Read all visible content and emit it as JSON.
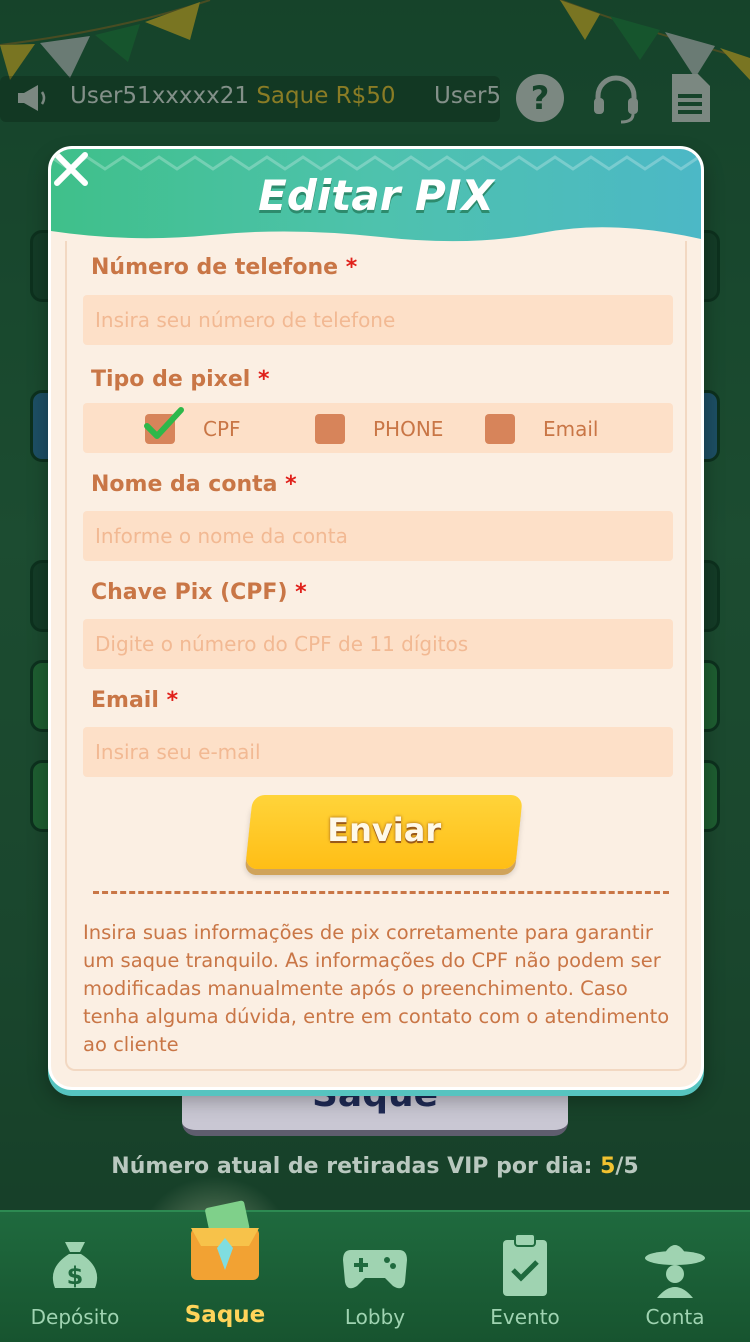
{
  "ticker": {
    "message_user": "User51xxxxx21",
    "message_amount": "Saque R$50",
    "message_next": "User5"
  },
  "top_icons": [
    "help-icon",
    "headset-icon",
    "document-icon"
  ],
  "background": {
    "saque_button_label": "Saque",
    "vip_line_prefix": "Número atual de retiradas VIP por dia: ",
    "vip_current": "5",
    "vip_total": "/5"
  },
  "modal": {
    "title": "Editar PIX",
    "fields": {
      "phone_label": "Número de telefone",
      "phone_placeholder": "Insira seu número de telefone",
      "pixel_type_label": "Tipo de pixel",
      "account_name_label": "Nome da conta",
      "account_name_placeholder": "Informe o nome da conta",
      "pix_key_label": "Chave Pix (CPF)",
      "pix_key_placeholder": "Digite o número do CPF de 11 dígitos",
      "email_label": "Email",
      "email_placeholder": "Insira seu e-mail"
    },
    "required_mark": "*",
    "pixel_types": [
      {
        "label": "CPF",
        "checked": true
      },
      {
        "label": "PHONE",
        "checked": false
      },
      {
        "label": "Email",
        "checked": false
      }
    ],
    "submit_label": "Enviar",
    "note": "Insira suas informações de pix corretamente para garantir um saque tranquilo. As informações do CPF não podem ser modificadas manualmente após o preenchimento. Caso tenha alguma dúvida, entre em contato com o atendimento ao cliente"
  },
  "nav": {
    "items": [
      {
        "label": "Depósito",
        "icon": "money-bag-icon"
      },
      {
        "label": "Saque",
        "icon": "wallet-icon",
        "active": true
      },
      {
        "label": "Lobby",
        "icon": "gamepad-icon"
      },
      {
        "label": "Evento",
        "icon": "clipboard-check-icon"
      },
      {
        "label": "Conta",
        "icon": "sombrero-icon"
      }
    ]
  },
  "colors": {
    "accent_orange": "#c97646",
    "required_red": "#e0201a",
    "header_green": "#3fc08a",
    "button_yellow": "#ffc826",
    "active_nav": "#ffd45a"
  }
}
